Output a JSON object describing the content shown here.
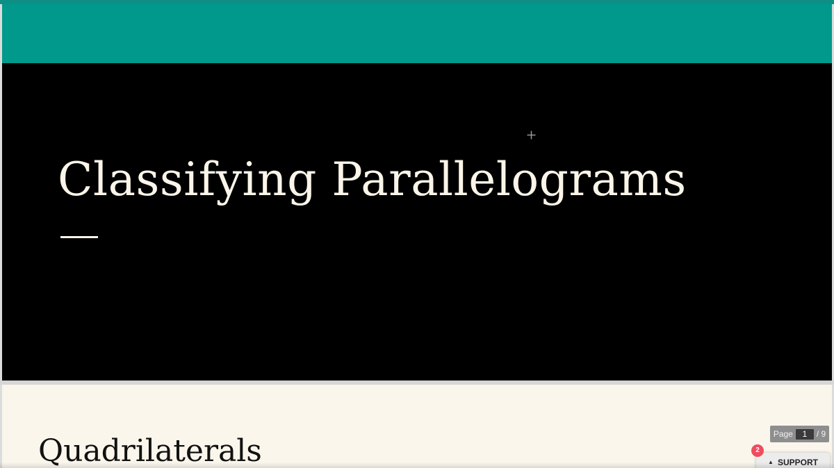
{
  "slides": [
    {
      "title": "Classifying Parallelograms",
      "colors": {
        "band": "#00998c",
        "background": "#000000",
        "title": "#faf5e8"
      }
    },
    {
      "heading": "Quadrilaterals",
      "colors": {
        "background": "#faf6ec",
        "heading": "#111111"
      }
    }
  ],
  "page_indicator": {
    "label": "Page",
    "current": "1",
    "total": "/ 9"
  },
  "support": {
    "label": "SUPPORT",
    "caret_icon": "caret-up-icon",
    "badge_count": "2",
    "badge_color": "#f04b5e"
  },
  "cursor": {
    "icon": "move-cursor-icon"
  }
}
